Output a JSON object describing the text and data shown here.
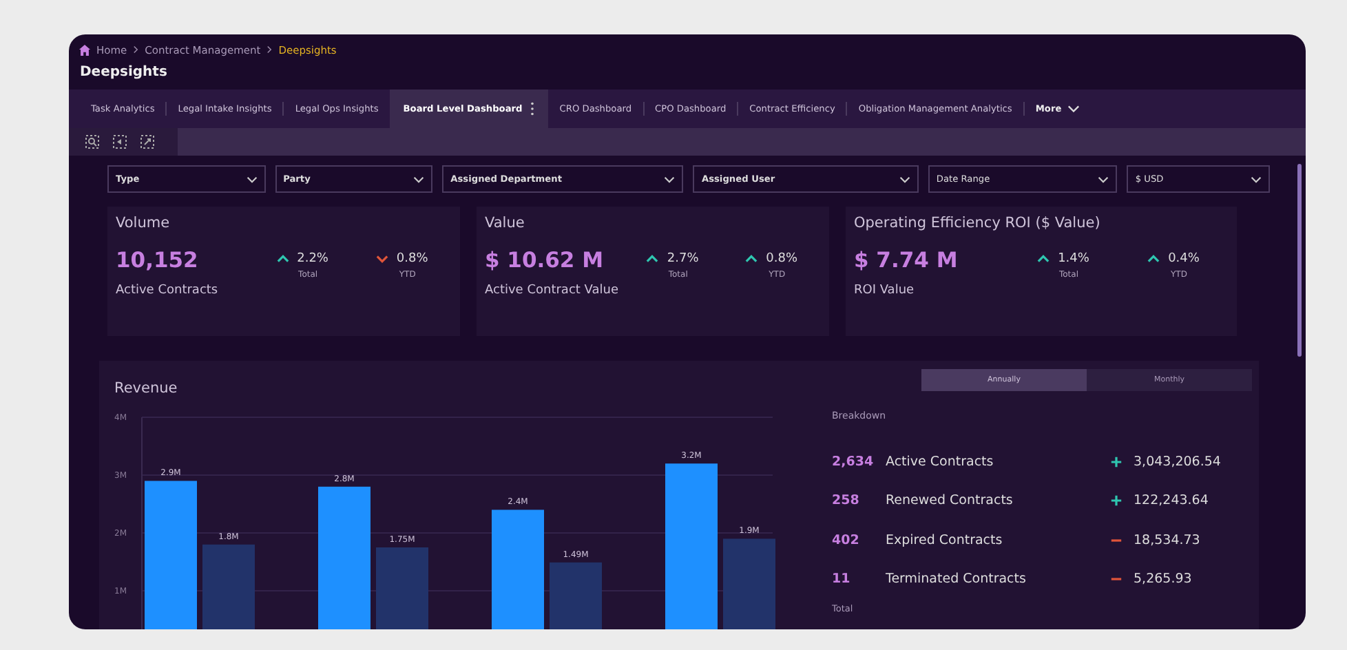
{
  "breadcrumb": {
    "items": [
      "Home",
      "Contract Management"
    ],
    "current": "Deepsights"
  },
  "page_title": "Deepsights",
  "tabs": [
    {
      "label": "Task Analytics",
      "selected": false
    },
    {
      "label": "Legal Intake Insights",
      "selected": false
    },
    {
      "label": "Legal Ops Insights",
      "selected": false
    },
    {
      "label": "Board Level Dashboard",
      "selected": true
    },
    {
      "label": "CRO Dashboard",
      "selected": false
    },
    {
      "label": "CPO Dashboard",
      "selected": false
    },
    {
      "label": "Contract Efficiency",
      "selected": false
    },
    {
      "label": "Obligation Management Analytics",
      "selected": false
    }
  ],
  "more_menu": "More",
  "filters": [
    {
      "label": "Type",
      "bold": true
    },
    {
      "label": "Party",
      "bold": true
    },
    {
      "label": "Assigned Department",
      "bold": true
    },
    {
      "label": "Assigned User",
      "bold": true
    },
    {
      "label": "Date Range",
      "bold": false
    },
    {
      "label": "$ USD",
      "bold": false
    }
  ],
  "cards": [
    {
      "title": "Volume",
      "value": "10,152",
      "caption": "Active Contracts",
      "stats": [
        {
          "kind": "up",
          "value": "2.2%",
          "label": "Total"
        },
        {
          "kind": "down",
          "value": "0.8%",
          "label": "YTD"
        }
      ]
    },
    {
      "title": "Value",
      "value": "$ 10.62 M",
      "caption": "Active Contract Value",
      "stats": [
        {
          "kind": "up",
          "value": "2.7%",
          "label": "Total"
        },
        {
          "kind": "up",
          "value": "0.8%",
          "label": "YTD"
        }
      ]
    },
    {
      "title": "Operating Efficiency ROI ($ Value)",
      "value": "$ 7.74 M",
      "caption": "ROI Value",
      "stats": [
        {
          "kind": "up",
          "value": "1.4%",
          "label": "Total"
        },
        {
          "kind": "up",
          "value": "0.4%",
          "label": "YTD"
        }
      ]
    }
  ],
  "revenue": {
    "title": "Revenue",
    "periods": [
      {
        "label": "Annually",
        "selected": true
      },
      {
        "label": "Monthly",
        "selected": false
      }
    ],
    "chart_data": {
      "type": "bar",
      "grid": true,
      "ylim": [
        0,
        4
      ],
      "yticks": [
        {
          "value": 1,
          "label": "1M"
        },
        {
          "value": 2,
          "label": "2M"
        },
        {
          "value": 3,
          "label": "3M"
        },
        {
          "value": 4,
          "label": "4M"
        }
      ],
      "data_labels": true,
      "series": [
        {
          "color": "#1e90ff",
          "values": [
            2.9,
            2.8,
            2.4,
            3.2
          ],
          "value_labels": [
            "2.9M",
            "2.8M",
            "2.4M",
            "3.2M"
          ]
        },
        {
          "color": "#22336a",
          "values": [
            1.8,
            1.75,
            1.49,
            1.9
          ],
          "value_labels": [
            "1.8M",
            "1.75M",
            "1.49M",
            "1.9M"
          ]
        }
      ]
    },
    "breakdown_title": "Breakdown",
    "breakdown": [
      {
        "count": "2,634",
        "label": "Active Contracts",
        "kind": "up",
        "amount": "3,043,206.54"
      },
      {
        "count": "258",
        "label": "Renewed Contracts",
        "kind": "up",
        "amount": "122,243.64"
      },
      {
        "count": "402",
        "label": "Expired Contracts",
        "kind": "down",
        "amount": "18,534.73"
      },
      {
        "count": "11",
        "label": "Terminated Contracts",
        "kind": "down",
        "amount": "5,265.93"
      }
    ],
    "total_label": "Total"
  }
}
